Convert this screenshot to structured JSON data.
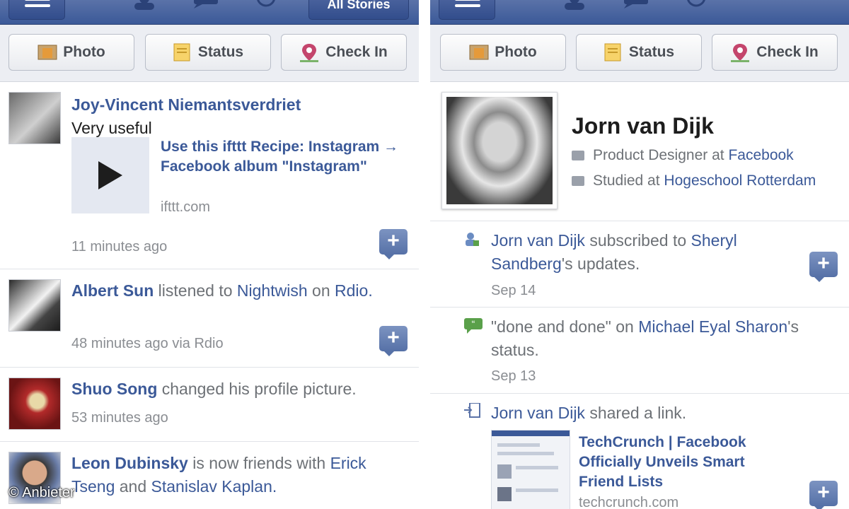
{
  "composer": {
    "photo": "Photo",
    "status": "Status",
    "checkin": "Check In"
  },
  "left": {
    "stories_button": "All Stories",
    "stories": [
      {
        "name": "Joy-Vincent Niemantsverdriet",
        "message": "Very useful",
        "attachment": {
          "title": "Use this ifttt Recipe: Instagram → Facebook album \"Instagram\"",
          "domain": "ifttt.com"
        },
        "time": "11 minutes ago"
      },
      {
        "name": "Albert Sun",
        "verb": "listened to",
        "target": "Nightwish",
        "on": "on",
        "app": "Rdio.",
        "time": "48 minutes ago via Rdio"
      },
      {
        "name": "Shuo Song",
        "verb": "changed his profile picture.",
        "time": "53 minutes ago"
      },
      {
        "name": "Leon Dubinsky",
        "verb": "is now friends with",
        "friend1": "Erick Tseng",
        "and": "and",
        "friend2": "Stanislav Kaplan."
      }
    ]
  },
  "right": {
    "profile": {
      "name": "Jorn van Dijk",
      "work_prefix": "Product Designer at",
      "work_link": "Facebook",
      "school_prefix": "Studied at",
      "school_link": "Hogeschool Rotterdam"
    },
    "activities": [
      {
        "actor": "Jorn van Dijk",
        "text": "subscribed to",
        "link": "Sheryl Sandberg",
        "suffix": "'s updates.",
        "date": "Sep 14"
      },
      {
        "quote": "\"done and done\" on",
        "link": "Michael Eyal Sharon",
        "suffix": "'s status.",
        "date": "Sep 13"
      },
      {
        "actor": "Jorn van Dijk",
        "text": "shared a link.",
        "link_title": "TechCrunch | Facebook Officially Unveils Smart Friend Lists",
        "link_domain": "techcrunch.com"
      }
    ]
  },
  "watermark": "© Anbieter",
  "colors": {
    "fb_blue": "#3b5998",
    "link": "#3b5998",
    "meta": "#8a8d92"
  }
}
